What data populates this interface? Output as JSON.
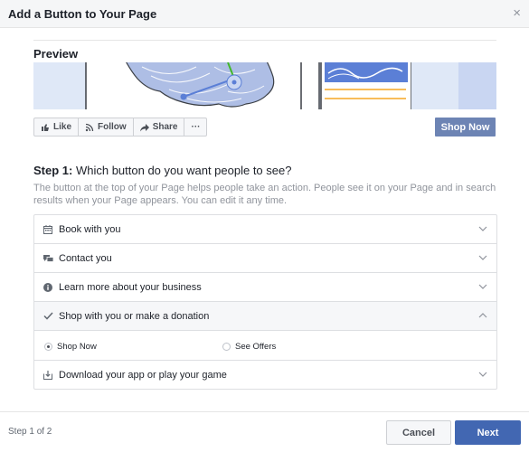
{
  "dialog": {
    "title": "Add a Button to Your Page",
    "close_glyph": "×"
  },
  "preview": {
    "title": "Preview",
    "page_buttons": [
      {
        "label": "Like",
        "icon": "thumbs-up-icon"
      },
      {
        "label": "Follow",
        "icon": "rss-icon"
      },
      {
        "label": "Share",
        "icon": "share-arrow-icon"
      },
      {
        "label": "···",
        "icon": "more-icon"
      }
    ],
    "cta_label": "Shop Now"
  },
  "step": {
    "label": "Step 1:",
    "question": "Which button do you want people to see?",
    "description": "The button at the top of your Page helps people take an action. People see it on your Page and in search results when your Page appears. You can edit it any time."
  },
  "options": [
    {
      "label": "Book with you",
      "icon": "calendar-icon",
      "expanded": false
    },
    {
      "label": "Contact you",
      "icon": "chat-bubbles-icon",
      "expanded": false
    },
    {
      "label": "Learn more about your business",
      "icon": "info-icon",
      "expanded": false
    },
    {
      "label": "Shop with you or make a donation",
      "icon": "checkmark-icon",
      "expanded": true,
      "choices": [
        {
          "label": "Shop Now",
          "selected": true
        },
        {
          "label": "See Offers",
          "selected": false
        }
      ]
    },
    {
      "label": "Download your app or play your game",
      "icon": "download-icon",
      "expanded": false
    }
  ],
  "footer": {
    "step_count": "Step 1 of 2",
    "cancel_label": "Cancel",
    "next_label": "Next"
  },
  "colors": {
    "primary": "#4267b2",
    "cta": "#6d84b4",
    "cover_bg": "#dfe8f7",
    "map_blue": "#5b7fd6",
    "accent_orange": "#f5a623",
    "accent_green": "#42b72a"
  }
}
